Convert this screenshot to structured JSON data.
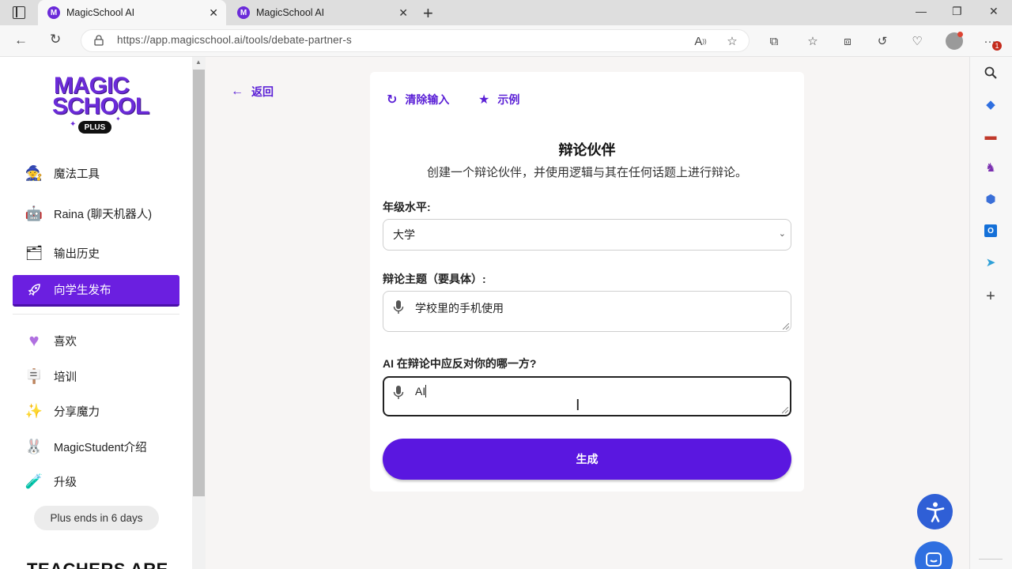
{
  "browser": {
    "tabs": [
      {
        "title": "MagicSchool AI",
        "favicon": "M",
        "active": true
      },
      {
        "title": "MagicSchool AI",
        "favicon": "M",
        "active": false
      }
    ],
    "url": "https://app.magicschool.ai/tools/debate-partner-s",
    "notification_count": "1"
  },
  "sidebar": {
    "logo_line1": "MAGIC",
    "logo_line2": "SCHOOL",
    "logo_badge": "PLUS",
    "items": [
      {
        "label": "魔法工具",
        "icon": "magic-tools-icon"
      },
      {
        "label": "Raina (聊天机器人)",
        "icon": "raina-robot-icon"
      },
      {
        "label": "输出历史",
        "icon": "output-history-icon"
      },
      {
        "label": "向学生发布",
        "icon": "rocket-icon",
        "active": true
      },
      {
        "label": "喜欢",
        "icon": "heart-icon"
      },
      {
        "label": "培训",
        "icon": "training-easel-icon"
      },
      {
        "label": "分享魔力",
        "icon": "sparkle-icon"
      },
      {
        "label": "MagicStudent介绍",
        "icon": "bunny-icon"
      },
      {
        "label": "升级",
        "icon": "potion-icon"
      }
    ],
    "plus_ends": "Plus ends in 6 days",
    "teachers_banner": "TEACHERS ARE"
  },
  "main": {
    "back_label": "返回",
    "clear_label": "清除输入",
    "example_label": "示例",
    "title": "辩论伙伴",
    "subtitle": "创建一个辩论伙伴，并使用逻辑与其在任何话题上进行辩论。",
    "grade_label": "年级水平:",
    "grade_value": "大学",
    "topic_label": "辩论主题（要具体）:",
    "topic_value": "学校里的手机使用",
    "side_label": "AI 在辩论中应反对你的哪一方?",
    "side_value": "AI",
    "generate_label": "生成"
  },
  "colors": {
    "brand_purple": "#5a17e0",
    "accessibility_blue": "#2f5fd6"
  }
}
